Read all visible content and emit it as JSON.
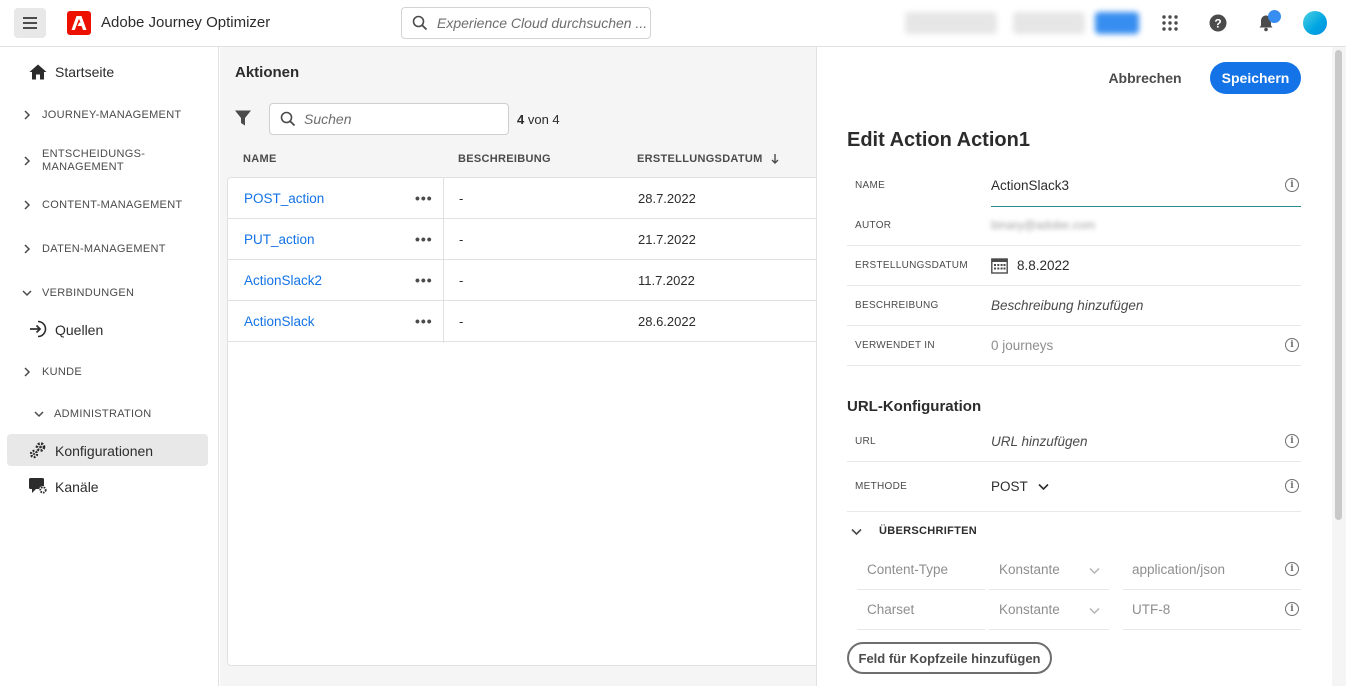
{
  "topbar": {
    "app_title": "Adobe Journey Optimizer",
    "search_placeholder": "Experience Cloud durchsuchen ..."
  },
  "sidebar": {
    "home": "Startseite",
    "sections": [
      {
        "label": "JOURNEY-MANAGEMENT"
      },
      {
        "label": "ENTSCHEIDUNGS-\nMANAGEMENT"
      },
      {
        "label": "CONTENT-MANAGEMENT"
      },
      {
        "label": "DATEN-MANAGEMENT"
      },
      {
        "label": "VERBINDUNGEN"
      },
      {
        "label": "KUNDE"
      },
      {
        "label": "ADMINISTRATION"
      }
    ],
    "sources": "Quellen",
    "configurations": "Konfigurationen",
    "channels": "Kanäle"
  },
  "list": {
    "title": "Aktionen",
    "search_placeholder": "Suchen",
    "count_bold": "4",
    "count_rest": " von 4",
    "columns": {
      "name": "NAME",
      "description": "BESCHREIBUNG",
      "created": "ERSTELLUNGSDATUM"
    },
    "rows": [
      {
        "name": "POST_action",
        "description": "-",
        "date": "28.7.2022"
      },
      {
        "name": "PUT_action",
        "description": "-",
        "date": "21.7.2022"
      },
      {
        "name": "ActionSlack2",
        "description": "-",
        "date": "11.7.2022"
      },
      {
        "name": "ActionSlack",
        "description": "-",
        "date": "28.6.2022"
      }
    ],
    "row_menu": "•••"
  },
  "panel": {
    "cancel": "Abbrechen",
    "save": "Speichern",
    "title": "Edit Action Action1",
    "fields": {
      "name_label": "NAME",
      "name_value": "ActionSlack3",
      "author_label": "AUTOR",
      "author_value": "binary@adobe.com",
      "created_label": "ERSTELLUNGSDATUM",
      "created_value": "8.8.2022",
      "description_label": "BESCHREIBUNG",
      "description_value": "Beschreibung hinzufügen",
      "used_in_label": "VERWENDET IN",
      "used_in_value": "0 journeys"
    },
    "url_section": {
      "title": "URL-Konfiguration",
      "url_label": "URL",
      "url_value": "URL hinzufügen",
      "method_label": "METHODE",
      "method_value": "POST"
    },
    "headers": {
      "title": "ÜBERSCHRIFTEN",
      "rows": [
        {
          "key": "Content-Type",
          "type": "Konstante",
          "value": "application/json"
        },
        {
          "key": "Charset",
          "type": "Konstante",
          "value": "UTF-8"
        }
      ],
      "add_button": "Feld für Kopfzeile hinzufügen"
    }
  },
  "colors": {
    "accent": "#1473e6",
    "adobe_red": "#eb1000",
    "notification": "#378ef0"
  }
}
